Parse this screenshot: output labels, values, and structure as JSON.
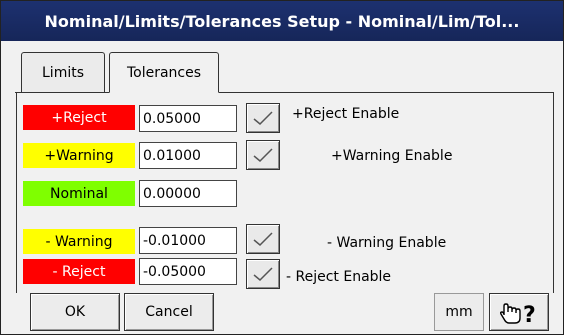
{
  "window": {
    "title": "Nominal/Limits/Tolerances Setup - Nominal/Lim/Tol..."
  },
  "tabs": [
    {
      "label": "Limits",
      "active": false
    },
    {
      "label": "Tolerances",
      "active": true
    }
  ],
  "tolerances": {
    "plus_reject": {
      "label": "+Reject",
      "value": "0.05000",
      "enable_label": "+Reject Enable",
      "enabled": true,
      "color": "#ff0000"
    },
    "plus_warning": {
      "label": "+Warning",
      "value": "0.01000",
      "enable_label": "+Warning Enable",
      "enabled": true,
      "color": "#ffff00"
    },
    "nominal": {
      "label": "Nominal",
      "value": "0.00000",
      "color": "#7fff00"
    },
    "minus_warning": {
      "label": "- Warning",
      "value": "-0.01000",
      "enable_label": "- Warning Enable",
      "enabled": true,
      "color": "#ffff00"
    },
    "minus_reject": {
      "label": "- Reject",
      "value": "-0.05000",
      "enable_label": "- Reject Enable",
      "enabled": true,
      "color": "#ff0000"
    }
  },
  "footer": {
    "ok_label": "OK",
    "cancel_label": "Cancel",
    "unit": "mm",
    "help_icon": "pointing-hand-question-icon"
  },
  "colors": {
    "titlebar": "#1d3170",
    "dialog_bg": "#f1f1f1"
  }
}
